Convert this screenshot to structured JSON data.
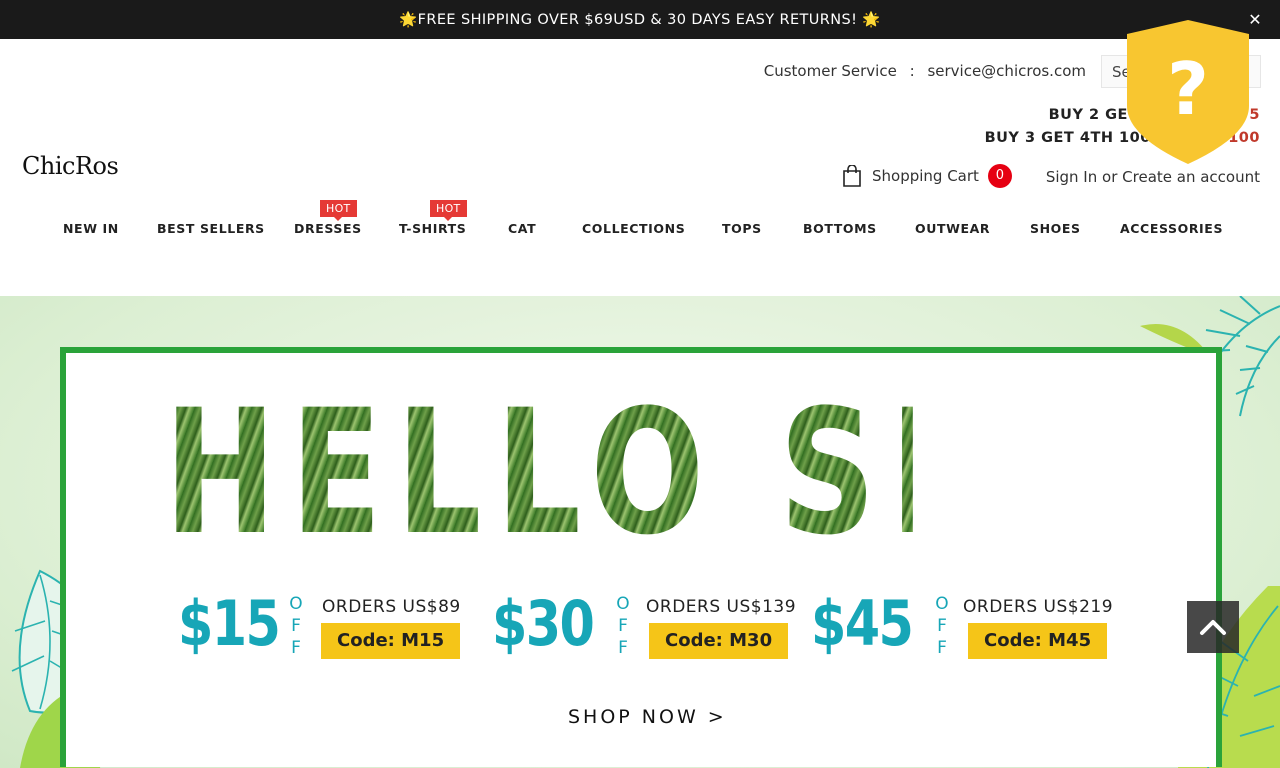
{
  "announcement": {
    "text": "🌟FREE SHIPPING OVER $69USD & 30 DAYS EASY RETURNS! 🌟",
    "close_glyph": "✕"
  },
  "header": {
    "customer_service_label": "Customer Service",
    "separator": ":",
    "email": "service@chicros.com",
    "search_value": "Se",
    "promo_line1": "BUY 2 GET 3RD 75% O",
    "promo_line1_tail": "75",
    "promo_line2": "BUY 3 GET 4TH 100% OFF -",
    "promo_line2_tail": "C100",
    "logo": "ChicRos",
    "cart_label": "Shopping Cart",
    "cart_count": "0",
    "sign_in": "Sign In",
    "or": "or",
    "create_account": "Create an account"
  },
  "nav": {
    "items": [
      {
        "label": "NEW IN"
      },
      {
        "label": "BEST SELLERS"
      },
      {
        "label": "DRESSES",
        "badge": "HOT"
      },
      {
        "label": "T-SHIRTS",
        "badge": "HOT"
      },
      {
        "label": "CAT"
      },
      {
        "label": "COLLECTIONS"
      },
      {
        "label": "TOPS"
      },
      {
        "label": "BOTTOMS"
      },
      {
        "label": "OUTWEAR"
      },
      {
        "label": "SHOES"
      },
      {
        "label": "ACCESSORIES"
      }
    ]
  },
  "overlay": {
    "glyph": "?",
    "color": "#f8c630"
  },
  "banner": {
    "headline": "HELLO SPRING",
    "deals": [
      {
        "amount": "$15",
        "off": [
          "O",
          "F",
          "F"
        ],
        "orders": "ORDERS US$89",
        "code": "Code: M15"
      },
      {
        "amount": "$30",
        "off": [
          "O",
          "F",
          "F"
        ],
        "orders": "ORDERS US$139",
        "code": "Code: M30"
      },
      {
        "amount": "$45",
        "off": [
          "O",
          "F",
          "F"
        ],
        "orders": "ORDERS US$219",
        "code": "Code: M45"
      }
    ],
    "cta": "SHOP NOW >",
    "accent_green": "#2aa33a",
    "accent_teal": "#17a6b7",
    "accent_yellow": "#f5c518"
  },
  "back_to_top": {
    "icon": "chevron-up-icon"
  }
}
